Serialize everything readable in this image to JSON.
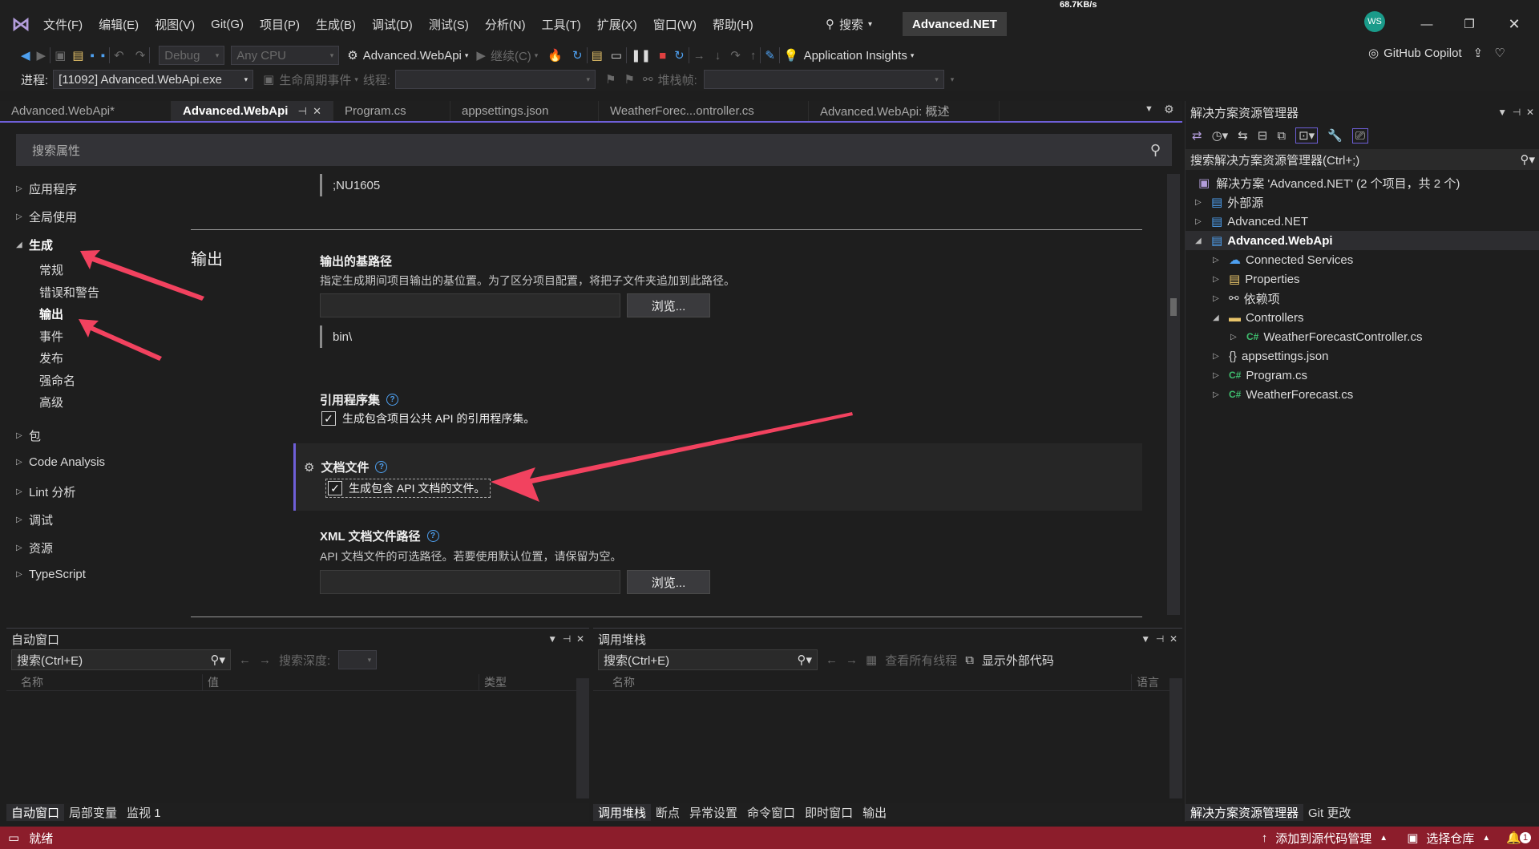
{
  "titlebar": {
    "menus": [
      "文件(F)",
      "编辑(E)",
      "视图(V)",
      "Git(G)",
      "项目(P)",
      "生成(B)",
      "调试(D)",
      "测试(S)",
      "分析(N)",
      "工具(T)",
      "扩展(X)",
      "窗口(W)",
      "帮助(H)"
    ],
    "search_label": "搜索",
    "solution_name": "Advanced.NET",
    "net_speed": "68.7KB/s",
    "avatar_initials": "WS"
  },
  "toolbar": {
    "config": "Debug",
    "platform": "Any CPU",
    "startup_project": "Advanced.WebApi",
    "continue_label": "继续(C)",
    "app_insights": "Application Insights",
    "copilot": "GitHub Copilot"
  },
  "debugbar": {
    "process_label": "进程:",
    "process_value": "[11092] Advanced.WebApi.exe",
    "lifecycle_label": "生命周期事件",
    "thread_label": "线程:",
    "stackframe_label": "堆栈帧:"
  },
  "doctabs": [
    {
      "label": "Advanced.WebApi*"
    },
    {
      "label": "Advanced.WebApi"
    },
    {
      "label": "Program.cs"
    },
    {
      "label": "appsettings.json"
    },
    {
      "label": "WeatherForec...ontroller.cs"
    },
    {
      "label": "Advanced.WebApi: 概述"
    }
  ],
  "props": {
    "search_placeholder": "搜索属性",
    "nav": {
      "app": "应用程序",
      "global": "全局使用",
      "build": "生成",
      "build_sub": [
        "常规",
        "错误和警告",
        "输出",
        "事件",
        "发布",
        "强命名",
        "高级"
      ],
      "package": "包",
      "code_analysis": "Code Analysis",
      "lint": "Lint 分析",
      "debug": "调试",
      "resources": "资源",
      "typescript": "TypeScript"
    },
    "nowarn_value": ";NU1605",
    "section_title": "输出",
    "base_output": {
      "label": "输出的基路径",
      "desc": "指定生成期间项目输出的基位置。为了区分项目配置，将把子文件夹追加到此路径。",
      "browse": "浏览...",
      "value": "bin\\"
    },
    "ref_assembly": {
      "label": "引用程序集",
      "checkbox": "生成包含项目公共 API 的引用程序集。"
    },
    "doc_file": {
      "label": "文档文件",
      "checkbox": "生成包含 API 文档的文件。"
    },
    "xml_path": {
      "label": "XML 文档文件路径",
      "desc": "API 文档文件的可选路径。若要使用默认位置，请保留为空。",
      "browse": "浏览..."
    }
  },
  "autos": {
    "title": "自动窗口",
    "search": "搜索(Ctrl+E)",
    "depth_label": "搜索深度:",
    "cols": [
      "名称",
      "值",
      "类型"
    ],
    "tabs": [
      "自动窗口",
      "局部变量",
      "监视 1"
    ]
  },
  "callstack": {
    "title": "调用堆栈",
    "search": "搜索(Ctrl+E)",
    "all_threads": "查看所有线程",
    "external_code": "显示外部代码",
    "cols": [
      "名称",
      "语言"
    ],
    "tabs": [
      "调用堆栈",
      "断点",
      "异常设置",
      "命令窗口",
      "即时窗口",
      "输出"
    ]
  },
  "solution": {
    "title": "解决方案资源管理器",
    "search": "搜索解决方案资源管理器(Ctrl+;)",
    "root": "解决方案 'Advanced.NET' (2 个项目，共 2 个)",
    "items": [
      "外部源",
      "Advanced.NET",
      "Advanced.WebApi",
      "Connected Services",
      "Properties",
      "依赖项",
      "Controllers",
      "WeatherForecastController.cs",
      "appsettings.json",
      "Program.cs",
      "WeatherForecast.cs"
    ],
    "tabs": [
      "解决方案资源管理器",
      "Git 更改"
    ]
  },
  "status": {
    "ready": "就绪",
    "add_source": "添加到源代码管理",
    "select_repo": "选择仓库",
    "notif_count": "1"
  },
  "colors": {
    "accent": "#6e5fd8",
    "status": "#8c1d2b",
    "annotation": "#f2425f"
  }
}
